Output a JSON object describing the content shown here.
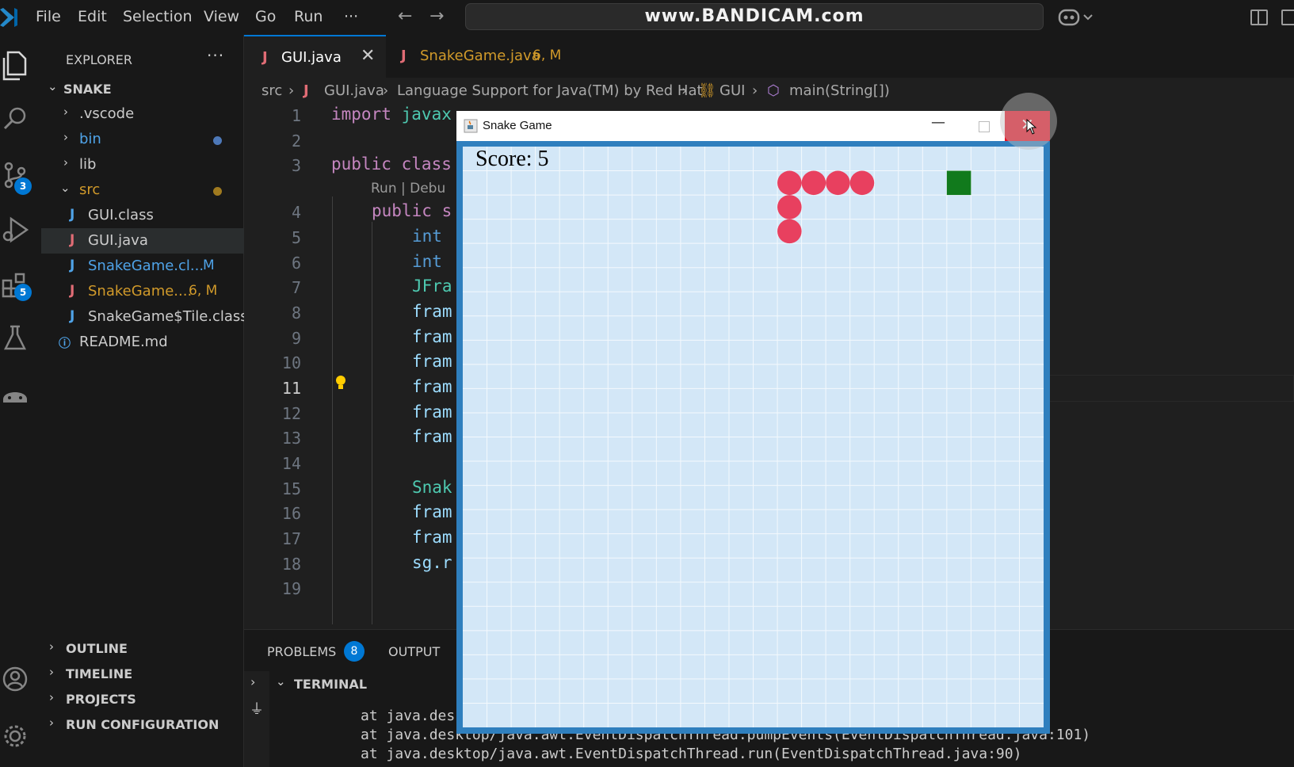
{
  "menu": {
    "file": "File",
    "edit": "Edit",
    "selection": "Selection",
    "view": "View",
    "go": "Go",
    "run": "Run",
    "more": "···"
  },
  "command_center": {
    "text": "www.BANDICAM.com"
  },
  "activity_badges": {
    "source_control": "3",
    "extensions": "5"
  },
  "explorer": {
    "title": "EXPLORER",
    "more": "···",
    "folder": "SNAKE",
    "items": [
      {
        "label": ".vscode",
        "kind": "folder"
      },
      {
        "label": "bin",
        "kind": "folder"
      },
      {
        "label": "lib",
        "kind": "folder"
      },
      {
        "label": "src",
        "kind": "folder"
      },
      {
        "label": "GUI.class",
        "kind": "file"
      },
      {
        "label": "GUI.java",
        "kind": "file"
      },
      {
        "label": "SnakeGame.cl...",
        "kind": "file",
        "marker": "M"
      },
      {
        "label": "SnakeGame....",
        "kind": "file",
        "marker": "6, M"
      },
      {
        "label": "SnakeGame$Tile.class",
        "kind": "file"
      },
      {
        "label": "README.md",
        "kind": "file"
      }
    ]
  },
  "sections": {
    "outline": "OUTLINE",
    "timeline": "TIMELINE",
    "projects": "PROJECTS",
    "run_configuration": "RUN CONFIGURATION"
  },
  "tabs": [
    {
      "label": "GUI.java",
      "close": "✕"
    },
    {
      "label": "SnakeGame.java",
      "marker": "6, M"
    }
  ],
  "breadcrumbs": {
    "src": "src",
    "file": "GUI.java",
    "ext": "Language Support for Java(TM) by Red Hat",
    "cls": "GUI",
    "method": "main(String[])"
  },
  "editor": {
    "line_numbers": [
      "1",
      "2",
      "3",
      "4",
      "5",
      "6",
      "7",
      "8",
      "9",
      "10",
      "11",
      "12",
      "13",
      "14",
      "15",
      "16",
      "17",
      "18",
      "19"
    ],
    "active_line": "11",
    "codelens": "Run | Debu",
    "lines": {
      "l1_kw": "import",
      "l1_rest": " javax",
      "l3_kw": "public",
      "l3_kw2": " class",
      "l4_kw": "public",
      "l4_rest": " s",
      "l5": "int",
      "l6": "int",
      "l7": "JFra",
      "l8": "fram",
      "l9": "fram",
      "l10": "fram",
      "l11": "fram",
      "l12": "fram",
      "l13": "fram",
      "l15": "Snak",
      "l16": "fram",
      "l17": "fram",
      "l18": "sg.r"
    }
  },
  "panel": {
    "problems": "PROBLEMS",
    "problems_count": "8",
    "output": "OUTPUT",
    "terminal": "TERMINAL",
    "terminal_lines": [
      "at java.des                                                   va:109)",
      "at java.desktop/java.awt.EventDispatchThread.pumpEvents(EventDispatchThread.java:101)",
      "at java.desktop/java.awt.EventDispatchThread.run(EventDispatchThread.java:90)"
    ]
  },
  "game": {
    "title": "Snake Game",
    "score_text": "Score: 5",
    "grid_cells": 24,
    "snake_color": "#e8405f",
    "food_color": "#117a1c",
    "snake": [
      [
        13,
        1
      ],
      [
        14,
        1
      ],
      [
        15,
        1
      ],
      [
        16,
        1
      ],
      [
        13,
        2
      ],
      [
        13,
        3
      ]
    ],
    "food": [
      20,
      1
    ]
  },
  "colors": {
    "accent": "#0078d4",
    "close_red": "#e81123"
  }
}
